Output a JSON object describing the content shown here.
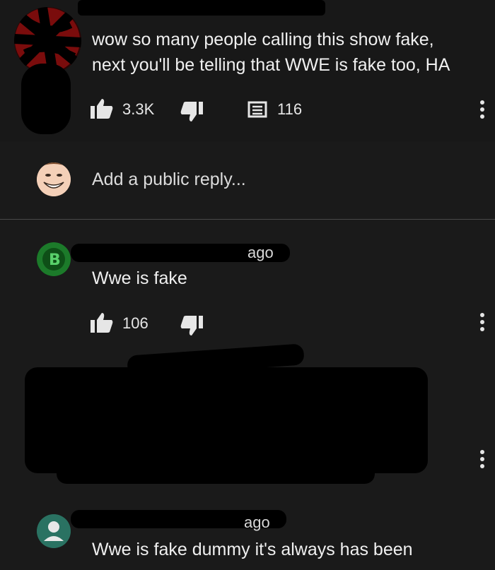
{
  "top_comment": {
    "text_line1": "wow so many people calling this show fake,",
    "text_line2": "next you'll be telling that WWE is fake too, HA",
    "likes": "3.3K",
    "replies": "116"
  },
  "reply_box": {
    "placeholder": "Add a public reply..."
  },
  "replies": [
    {
      "time": "ago",
      "text": "Wwe is fake",
      "likes": "106"
    },
    {
      "time": "ago",
      "text": "Wwe is fake dummy it's always has been"
    }
  ],
  "icons": [
    "like-icon",
    "dislike-icon",
    "reply-count-icon",
    "more-options-icon"
  ],
  "colors": {
    "background": "#1a1a1a",
    "text": "#f0f0f0",
    "redaction": "#000000"
  }
}
